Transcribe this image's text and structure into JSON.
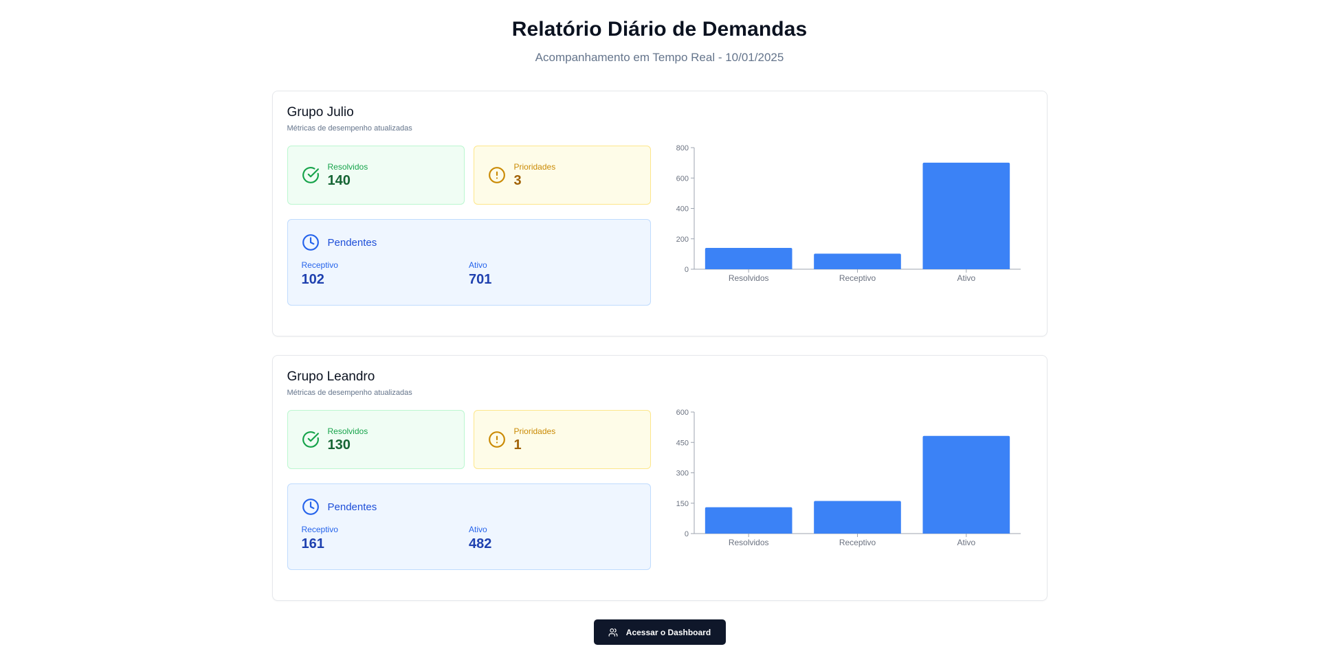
{
  "header": {
    "title": "Relatório Diário de Demandas",
    "subtitle": "Acompanhamento em Tempo Real - 10/01/2025"
  },
  "groups": [
    {
      "name": "Grupo Julio",
      "description": "Métricas de desempenho atualizadas",
      "resolved": {
        "label": "Resolvidos",
        "value": "140",
        "icon": "check-circle-icon"
      },
      "priority": {
        "label": "Prioridades",
        "value": "3",
        "icon": "alert-circle-icon"
      },
      "pending": {
        "title": "Pendentes",
        "icon": "clock-icon",
        "receptivo_label": "Receptivo",
        "receptivo_value": "102",
        "ativo_label": "Ativo",
        "ativo_value": "701"
      }
    },
    {
      "name": "Grupo Leandro",
      "description": "Métricas de desempenho atualizadas",
      "resolved": {
        "label": "Resolvidos",
        "value": "130",
        "icon": "check-circle-icon"
      },
      "priority": {
        "label": "Prioridades",
        "value": "1",
        "icon": "alert-circle-icon"
      },
      "pending": {
        "title": "Pendentes",
        "icon": "clock-icon",
        "receptivo_label": "Receptivo",
        "receptivo_value": "161",
        "ativo_label": "Ativo",
        "ativo_value": "482"
      }
    }
  ],
  "chart_data": [
    {
      "type": "bar",
      "categories": [
        "Resolvidos",
        "Receptivo",
        "Ativo"
      ],
      "values": [
        140,
        102,
        701
      ],
      "ylim": [
        0,
        800
      ],
      "yticks": [
        0,
        200,
        400,
        600,
        800
      ],
      "color": "#3b82f6",
      "grid": false
    },
    {
      "type": "bar",
      "categories": [
        "Resolvidos",
        "Receptivo",
        "Ativo"
      ],
      "values": [
        130,
        161,
        482
      ],
      "ylim": [
        0,
        600
      ],
      "yticks": [
        0,
        150,
        300,
        450,
        600
      ],
      "color": "#3b82f6",
      "grid": false
    }
  ],
  "footer": {
    "button_label": "Acessar o Dashboard",
    "button_icon": "users-icon"
  },
  "colors": {
    "resolved": "#16a34a",
    "priority": "#ca8a04",
    "pending": "#2563eb",
    "bar": "#3b82f6",
    "button": "#0f172a"
  }
}
